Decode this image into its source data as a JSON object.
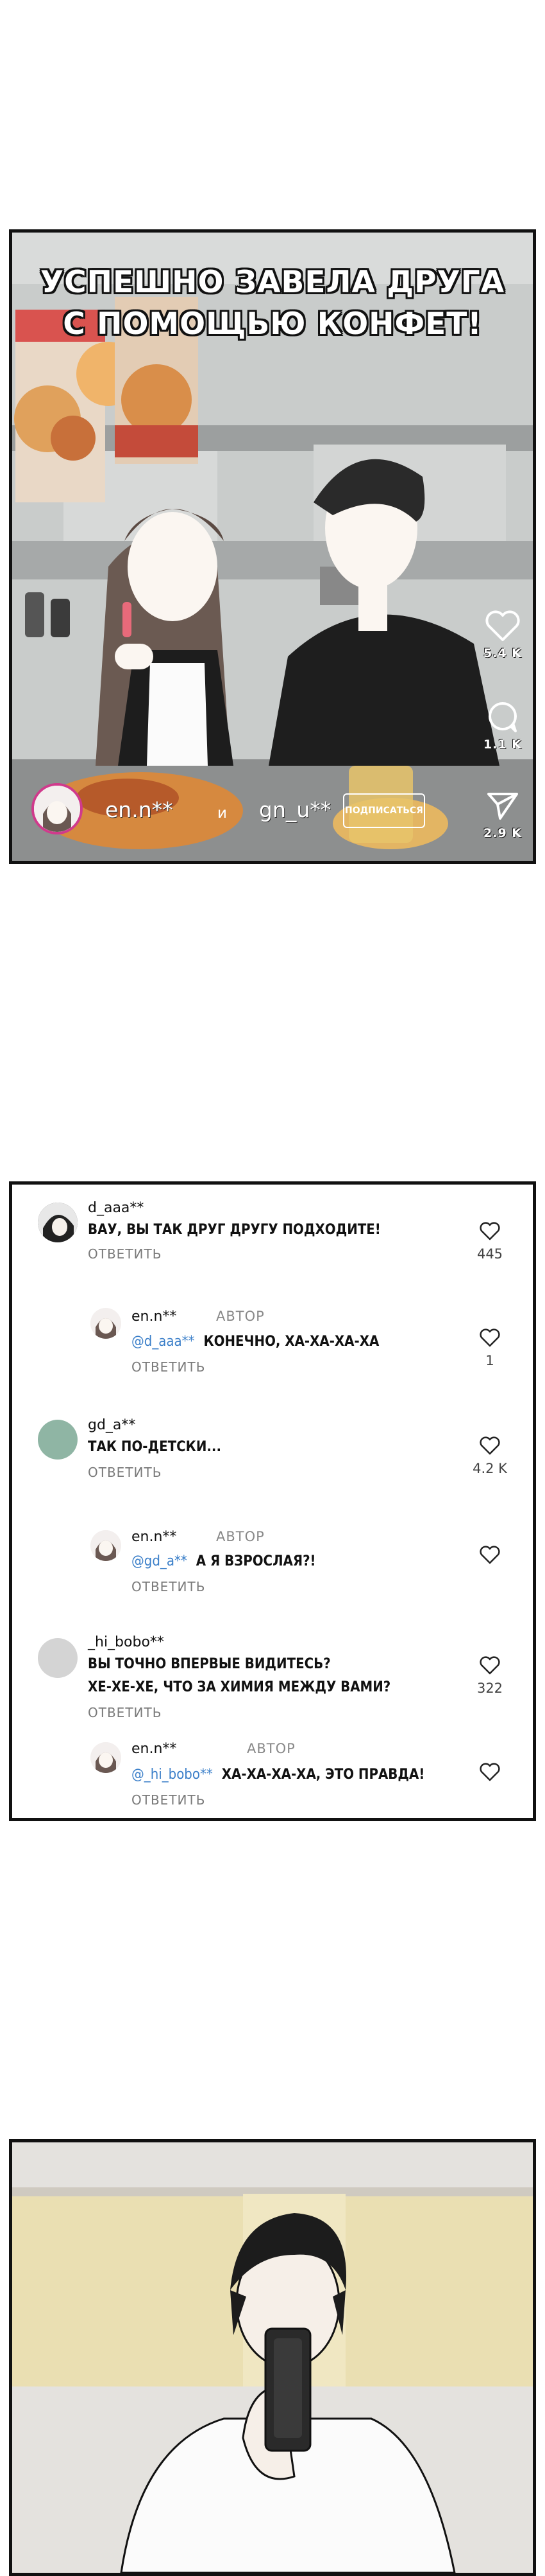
{
  "post": {
    "caption_line1": "УСПЕШНО ЗАВЕЛА ДРУГА",
    "caption_line2": "С ПОМОЩЬЮ КОНФЕТ!",
    "likes": "5.4 K",
    "comments": "1.1 K",
    "shares": "2.9 K",
    "author_a": "en.n**",
    "author_joiner": "и",
    "author_b": "gn_u**",
    "follow_label": "ПОДПИСАТЬСЯ"
  },
  "comments": [
    {
      "user": "d_aaa**",
      "text": "ВАУ, ВЫ ТАК ДРУГ ДРУГУ ПОДХОДИТЕ!",
      "reply_label": "ОТВЕТИТЬ",
      "likes": "445",
      "replies": [
        {
          "user": "en.n**",
          "badge": "АВТОР",
          "mention": "@d_aaa**",
          "text": "КОНЕЧНО, ХА-ХА-ХА-ХА",
          "reply_label": "ОТВЕТИТЬ",
          "likes": "1"
        }
      ]
    },
    {
      "user": "gd_a**",
      "text": "ТАК ПО-ДЕТСКИ...",
      "reply_label": "ОТВЕТИТЬ",
      "likes": "4.2 K",
      "replies": [
        {
          "user": "en.n**",
          "badge": "АВТОР",
          "mention": "@gd_a**",
          "text": "А Я ВЗРОСЛАЯ?!",
          "reply_label": "ОТВЕТИТЬ",
          "likes": ""
        }
      ]
    },
    {
      "user": "_hi_bobo**",
      "text_line1": "ВЫ ТОЧНО ВПЕРВЫЕ ВИДИТЕСЬ?",
      "text_line2": "ХЕ-ХЕ-ХЕ, ЧТО ЗА ХИМИЯ МЕЖДУ ВАМИ?",
      "reply_label": "ОТВЕТИТЬ",
      "likes": "322",
      "replies": [
        {
          "user": "en.n**",
          "badge": "АВТОР",
          "mention": "@_hi_bobo**",
          "text": "ХА-ХА-ХА-ХА, ЭТО ПРАВДА!",
          "reply_label": "ОТВЕТИТЬ",
          "likes": ""
        }
      ]
    }
  ],
  "colors": {
    "mention": "#3b7fc9",
    "follow_ring": "#d03a8c",
    "avatar_gd": "#8fb5a4",
    "avatar_hi": "#d4d4d4"
  }
}
